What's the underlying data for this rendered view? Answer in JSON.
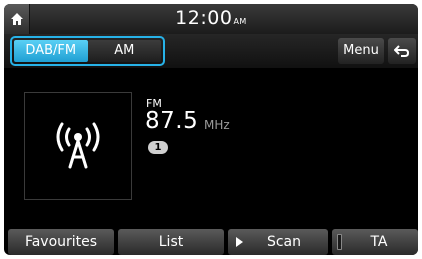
{
  "statusbar": {
    "home_icon": "home-icon",
    "time": "12:00",
    "ampm": "AM"
  },
  "band_tabs": [
    {
      "label": "DAB/FM",
      "selected": true
    },
    {
      "label": "AM",
      "selected": false
    }
  ],
  "header_buttons": {
    "menu_label": "Menu",
    "back_icon": "back-arrow-icon"
  },
  "station": {
    "art_icon": "radio-antenna-icon",
    "band": "FM",
    "frequency": "87.5",
    "unit": "MHz",
    "preset": "1"
  },
  "bottom_buttons": {
    "favourites": "Favourites",
    "list": "List",
    "scan": "Scan",
    "ta": "TA"
  },
  "colors": {
    "accent": "#27b2e8",
    "selected_tab": "#1f9fd3",
    "background": "#000000"
  }
}
